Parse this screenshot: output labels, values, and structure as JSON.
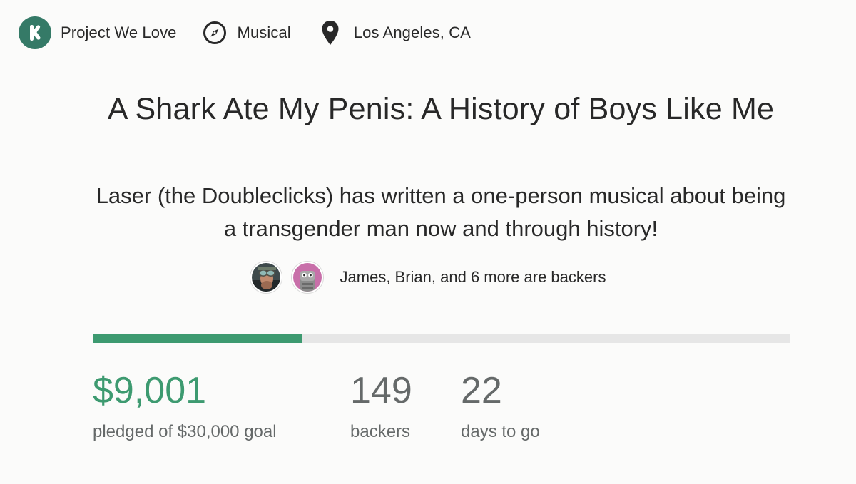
{
  "meta": {
    "badge_label": "Project We Love",
    "category": "Musical",
    "location": "Los Angeles, CA"
  },
  "project": {
    "title": "A Shark Ate My Penis: A History of Boys Like Me",
    "blurb": "Laser (the Doubleclicks) has written a one-person musical about being a transgender man now and through history!"
  },
  "social": {
    "backers_text": "James, Brian, and 6 more are backers"
  },
  "funding": {
    "progress_fraction": 0.3,
    "pledged": "$9,001",
    "pledged_caption": "pledged of $30,000 goal",
    "backers": "149",
    "backers_caption": "backers",
    "days": "22",
    "days_caption": "days to go"
  },
  "colors": {
    "brand_green": "#3d9a70",
    "badge_green": "#357a67",
    "text": "#282828",
    "muted": "#656969"
  },
  "icons": [
    "kickstarter-k-icon",
    "compass-icon",
    "location-pin-icon"
  ]
}
